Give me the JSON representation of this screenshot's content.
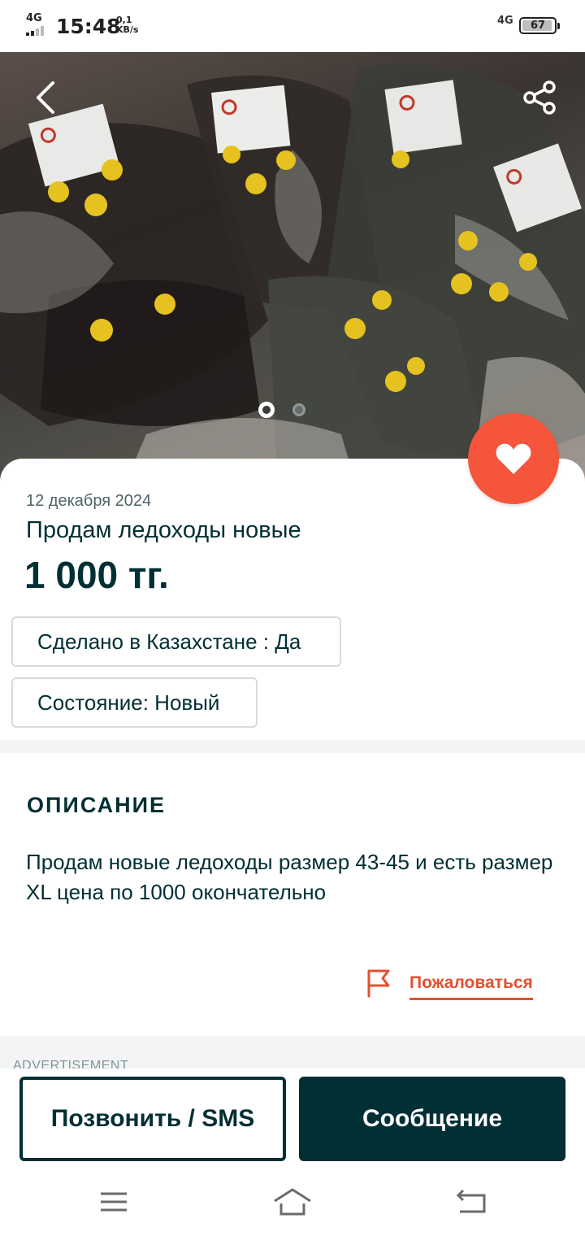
{
  "status_bar": {
    "network_left": "4G",
    "time": "15:48",
    "speed_value": "0,1",
    "speed_unit": "KB/s",
    "network_right": "4G",
    "battery": "67"
  },
  "gallery": {
    "photo_icon": "product-photo",
    "dots_total": 2,
    "dot_active_index": 0
  },
  "listing": {
    "date": "12 декабря 2024",
    "title": "Продам ледоходы новые",
    "price": "1 000 тг.",
    "params": [
      "Сделано в Казахстане : Да",
      "Состояние: Новый"
    ]
  },
  "description": {
    "heading": "ОПИСАНИЕ",
    "text": "Продам новые ледоходы размер 43-45 и есть размер XL цена по 1000 окончательно"
  },
  "report": {
    "label": "Пожаловаться"
  },
  "advertisement_label": "ADVERTISEMENT",
  "actions": {
    "call_label": "Позвонить / SMS",
    "message_label": "Сообщение"
  },
  "colors": {
    "primary": "#002f34",
    "accent": "#f5553a",
    "report": "#e4502f"
  },
  "icons": {
    "back": "back-arrow-icon",
    "share": "share-icon",
    "favorite": "heart-icon",
    "report": "flag-icon",
    "nav_menu": "menu-icon",
    "nav_home": "home-icon",
    "nav_back": "return-icon"
  }
}
